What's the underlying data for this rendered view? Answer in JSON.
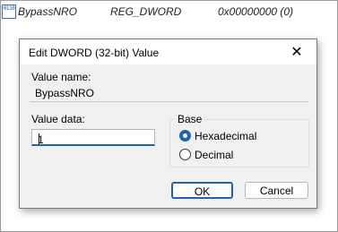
{
  "registry_row": {
    "icon_text": "0110",
    "name": "BypassNRO",
    "type": "REG_DWORD",
    "data": "0x00000000 (0)"
  },
  "dialog": {
    "title": "Edit DWORD (32-bit) Value",
    "close_glyph": "✕",
    "value_name_label": "Value name:",
    "value_name": "BypassNRO",
    "value_data_label": "Value data:",
    "value_data": "1",
    "base_label": "Base",
    "base_options": [
      {
        "label": "Hexadecimal",
        "selected": true
      },
      {
        "label": "Decimal",
        "selected": false
      }
    ],
    "ok_label": "OK",
    "cancel_label": "Cancel"
  },
  "colors": {
    "accent": "#1f63b5",
    "dialog_bg": "#f0f0f0"
  }
}
